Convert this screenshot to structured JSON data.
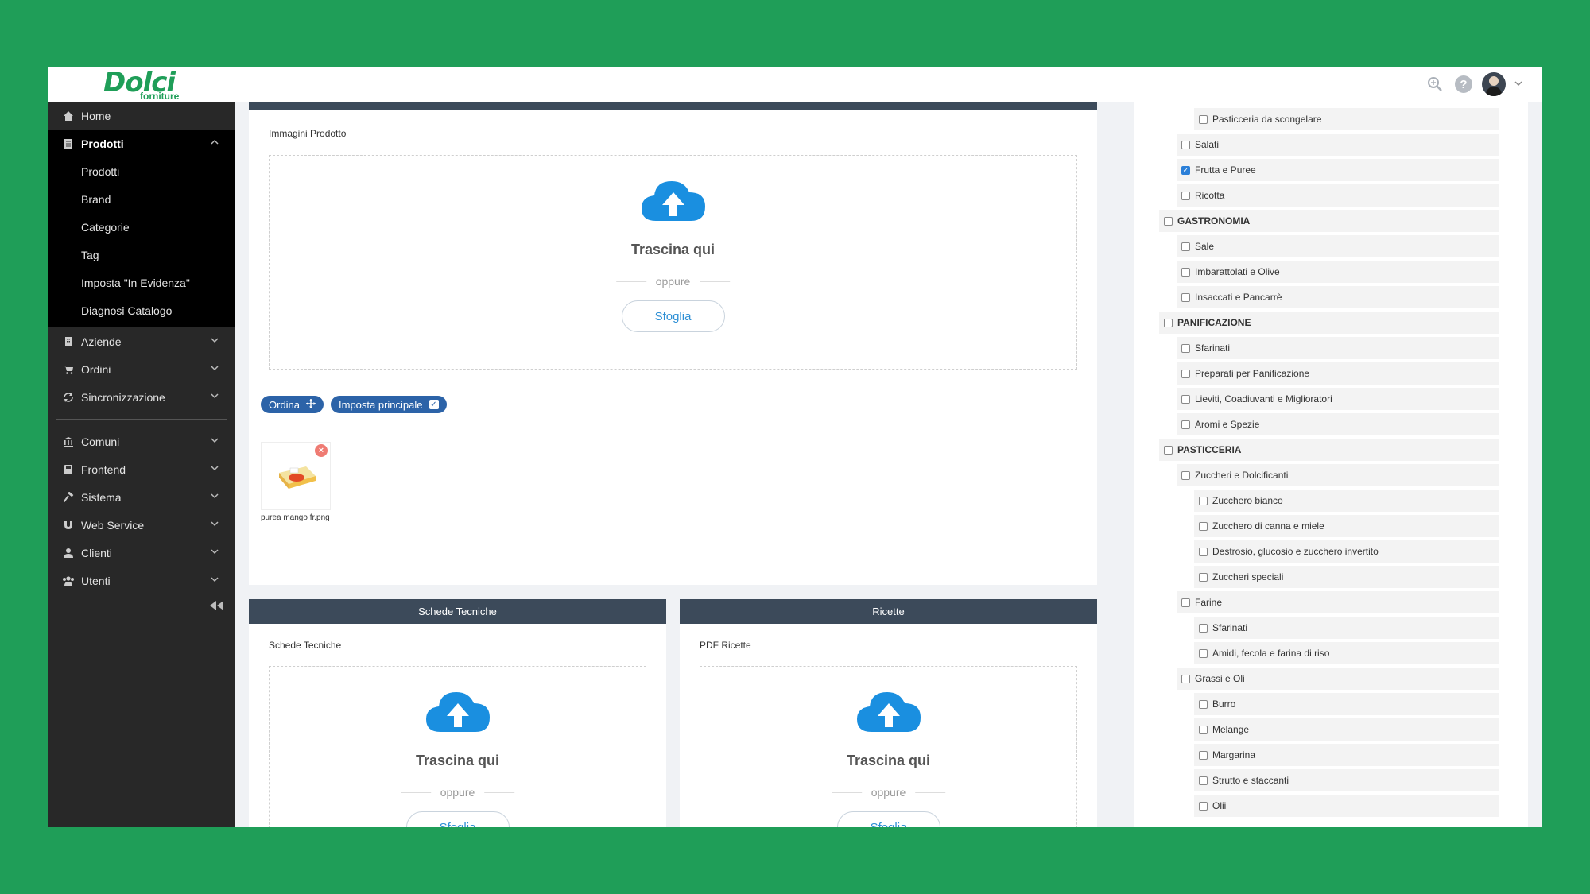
{
  "brand": {
    "name": "Dolci",
    "tagline": "forniture"
  },
  "sidebar": {
    "items": [
      {
        "label": "Home",
        "icon": "home-icon"
      },
      {
        "label": "Prodotti",
        "icon": "doc-icon",
        "open": true,
        "children": [
          "Prodotti",
          "Brand",
          "Categorie",
          "Tag",
          "Imposta \"In Evidenza\"",
          "Diagnosi Catalogo"
        ]
      },
      {
        "label": "Aziende",
        "icon": "building-icon"
      },
      {
        "label": "Ordini",
        "icon": "cart-icon"
      },
      {
        "label": "Sincronizzazione",
        "icon": "sync-icon"
      },
      {
        "label": "Comuni",
        "icon": "bank-icon"
      },
      {
        "label": "Frontend",
        "icon": "frontend-icon"
      },
      {
        "label": "Sistema",
        "icon": "hammer-icon"
      },
      {
        "label": "Web Service",
        "icon": "ws-icon"
      },
      {
        "label": "Clienti",
        "icon": "user-icon"
      },
      {
        "label": "Utenti",
        "icon": "users-icon"
      }
    ]
  },
  "images_panel": {
    "label": "Immagini Prodotto",
    "drop_title": "Trascina qui",
    "or": "oppure",
    "browse": "Sfoglia",
    "order_label": "Ordina",
    "set_main_label": "Imposta principale",
    "file_name": "purea mango fr.png"
  },
  "tech_sheets": {
    "header": "Schede Tecniche",
    "label": "Schede Tecniche",
    "drop_title": "Trascina qui",
    "or": "oppure",
    "browse": "Sfoglia"
  },
  "recipes": {
    "header": "Ricette",
    "label": "PDF Ricette",
    "drop_title": "Trascina qui",
    "or": "oppure",
    "browse": "Sfoglia"
  },
  "categories": [
    {
      "label": "Pasticceria da scongelare",
      "level": 2,
      "checked": false
    },
    {
      "label": "Salati",
      "level": 1,
      "checked": false
    },
    {
      "label": "Frutta e Puree",
      "level": 1,
      "checked": true
    },
    {
      "label": "Ricotta",
      "level": 1,
      "checked": false
    },
    {
      "label": "GASTRONOMIA",
      "level": 0,
      "checked": false
    },
    {
      "label": "Sale",
      "level": 1,
      "checked": false
    },
    {
      "label": "Imbarattolati e Olive",
      "level": 1,
      "checked": false
    },
    {
      "label": "Insaccati e Pancarrè",
      "level": 1,
      "checked": false
    },
    {
      "label": "PANIFICAZIONE",
      "level": 0,
      "checked": false
    },
    {
      "label": "Sfarinati",
      "level": 1,
      "checked": false
    },
    {
      "label": "Preparati per Panificazione",
      "level": 1,
      "checked": false
    },
    {
      "label": "Lieviti, Coadiuvanti e Miglioratori",
      "level": 1,
      "checked": false
    },
    {
      "label": "Aromi e Spezie",
      "level": 1,
      "checked": false
    },
    {
      "label": "PASTICCERIA",
      "level": 0,
      "checked": false
    },
    {
      "label": "Zuccheri e Dolcificanti",
      "level": 1,
      "checked": false
    },
    {
      "label": "Zucchero bianco",
      "level": 2,
      "checked": false
    },
    {
      "label": "Zucchero di canna e miele",
      "level": 2,
      "checked": false
    },
    {
      "label": "Destrosio, glucosio e zucchero invertito",
      "level": 2,
      "checked": false
    },
    {
      "label": "Zuccheri speciali",
      "level": 2,
      "checked": false
    },
    {
      "label": "Farine",
      "level": 1,
      "checked": false
    },
    {
      "label": "Sfarinati",
      "level": 2,
      "checked": false
    },
    {
      "label": "Amidi, fecola e farina di riso",
      "level": 2,
      "checked": false
    },
    {
      "label": "Grassi e Oli",
      "level": 1,
      "checked": false
    },
    {
      "label": "Burro",
      "level": 2,
      "checked": false
    },
    {
      "label": "Melange",
      "level": 2,
      "checked": false
    },
    {
      "label": "Margarina",
      "level": 2,
      "checked": false
    },
    {
      "label": "Strutto e staccanti",
      "level": 2,
      "checked": false
    },
    {
      "label": "Olii",
      "level": 2,
      "checked": false
    }
  ],
  "colors": {
    "background": "#1f9e58",
    "sidebar": "#282828",
    "header": "#3c4a5a",
    "accent": "#2c63a8",
    "cloud": "#1a8fe0"
  }
}
